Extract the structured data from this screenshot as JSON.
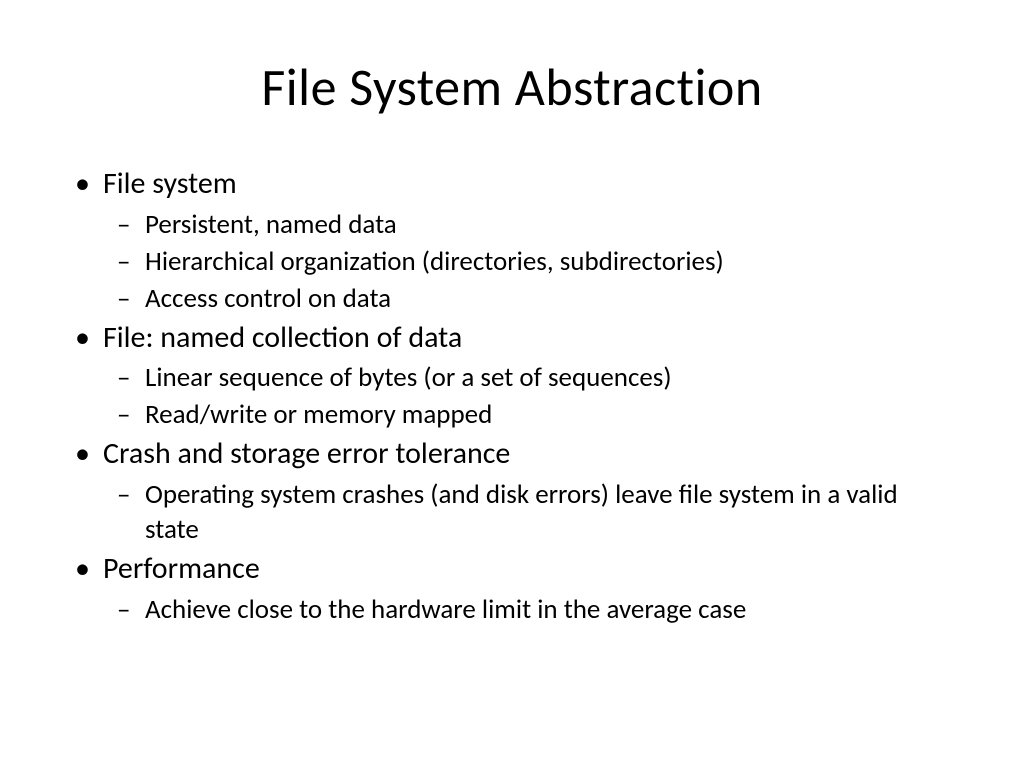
{
  "slide": {
    "title": "File System Abstraction",
    "bullets": [
      {
        "text": "File system",
        "subbullets": [
          "Persistent, named data",
          "Hierarchical organization (directories, subdirectories)",
          "Access control on data"
        ]
      },
      {
        "text": "File: named collection of data",
        "subbullets": [
          "Linear sequence of bytes (or a set of sequences)",
          "Read/write or memory mapped"
        ]
      },
      {
        "text": "Crash and storage error tolerance",
        "subbullets": [
          "Operating system crashes (and disk errors) leave file system in a valid state"
        ]
      },
      {
        "text": "Performance",
        "subbullets": [
          "Achieve close to the hardware limit in the average case"
        ]
      }
    ]
  }
}
